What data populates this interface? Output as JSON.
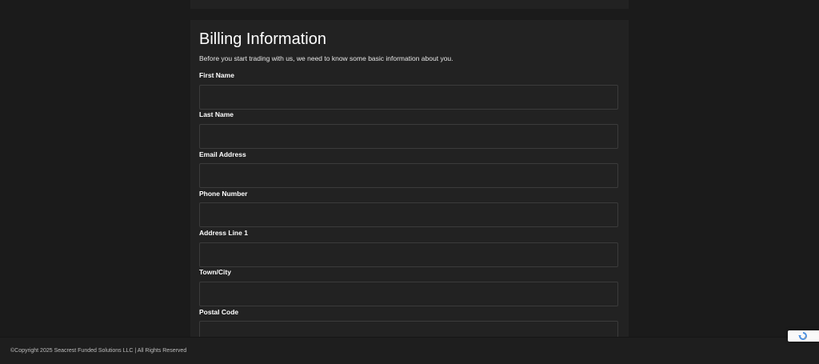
{
  "billing": {
    "title": "Billing Information",
    "subtitle": "Before you start trading with us, we need to know some basic information about you.",
    "fields": [
      {
        "label": "First Name",
        "value": "",
        "placeholder": ""
      },
      {
        "label": "Last Name",
        "value": "",
        "placeholder": ""
      },
      {
        "label": "Email Address",
        "value": "",
        "placeholder": ""
      },
      {
        "label": "Phone Number",
        "value": "",
        "placeholder": ""
      },
      {
        "label": "Address Line 1",
        "value": "",
        "placeholder": ""
      },
      {
        "label": "Town/City",
        "value": "",
        "placeholder": ""
      },
      {
        "label": "Postal Code",
        "value": "",
        "placeholder": ""
      }
    ]
  },
  "footer": {
    "copyright": "©Copyright 2025 Seacrest Funded Solutions LLC | All Rights Reserved"
  },
  "icons": {
    "recaptcha": "recaptcha-icon"
  },
  "colors": {
    "page_background": "#1b1b1b",
    "card_background": "#222222",
    "input_border": "#3b3b3b",
    "recaptcha_blue": "#4a90e2"
  }
}
